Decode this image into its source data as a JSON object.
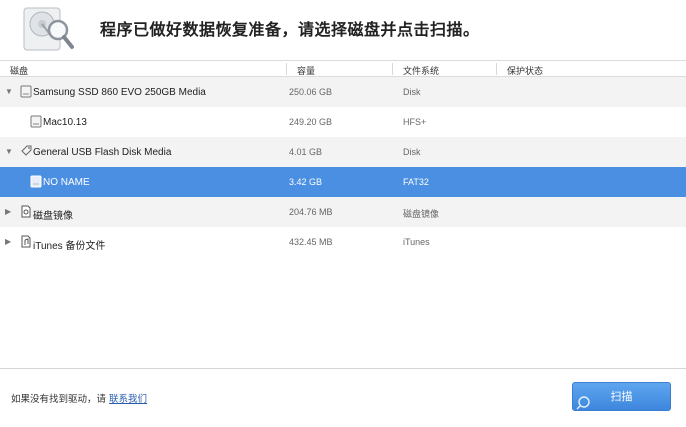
{
  "header": {
    "title": "程序已做好数据恢复准备，请选择磁盘并点击扫描。"
  },
  "columns": {
    "disk": "磁盘",
    "capacity": "容量",
    "filesystem": "文件系统",
    "protection": "保护状态"
  },
  "disks": [
    {
      "name": "Samsung SSD 860 EVO 250GB Media",
      "capacity": "250.06 GB",
      "filesystem": "Disk",
      "icon": "drive-icon",
      "expander": "expanded"
    },
    {
      "name": "Mac10.13",
      "capacity": "249.20 GB",
      "filesystem": "HFS+",
      "icon": "volume-icon",
      "expander": "none"
    },
    {
      "name": "General USB Flash Disk Media",
      "capacity": "4.01 GB",
      "filesystem": "Disk",
      "icon": "usb-tag-icon",
      "expander": "expanded"
    },
    {
      "name": "NO NAME",
      "capacity": "3.42 GB",
      "filesystem": "FAT32",
      "icon": "volume-icon",
      "expander": "none",
      "selected": true
    },
    {
      "name": "磁盘镜像",
      "capacity": "204.76 MB",
      "filesystem": "磁盘镜像",
      "icon": "document-icon",
      "expander": "collapsed"
    },
    {
      "name": "iTunes 备份文件",
      "capacity": "432.45 MB",
      "filesystem": "iTunes",
      "icon": "document-icon",
      "expander": "collapsed"
    }
  ],
  "footer": {
    "note": "如果没有找到驱动，请",
    "contact_link": "联系我们",
    "scan_label": "扫描"
  },
  "colors": {
    "selection": "#4a8fe2",
    "button": "#3d86dd"
  }
}
